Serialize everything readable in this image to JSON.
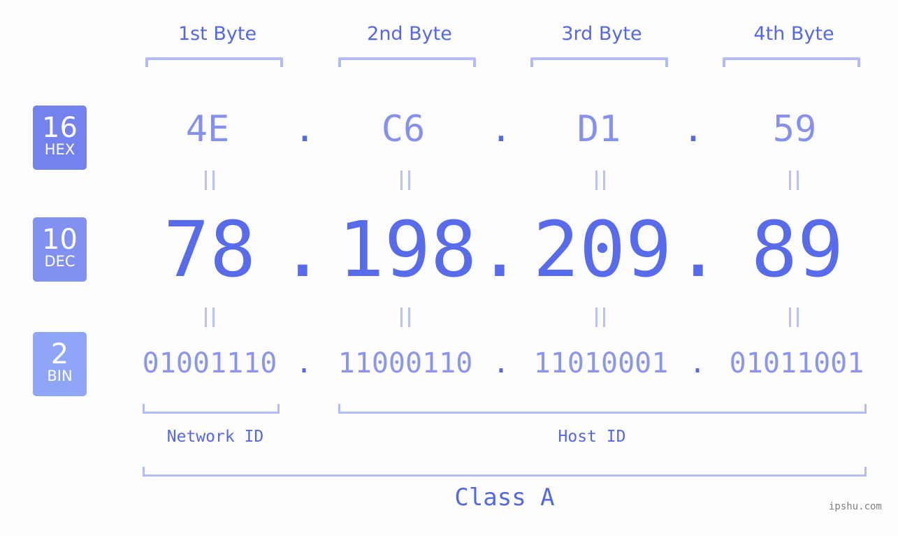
{
  "headers": [
    "1st Byte",
    "2nd Byte",
    "3rd Byte",
    "4th Byte"
  ],
  "badges": [
    {
      "num": "16",
      "label": "HEX",
      "color": "#7382ec"
    },
    {
      "num": "10",
      "label": "DEC",
      "color": "#8291f0"
    },
    {
      "num": "2",
      "label": "BIN",
      "color": "#8fa6f6"
    }
  ],
  "hex": [
    "4E",
    "C6",
    "D1",
    "59"
  ],
  "dec": [
    "78",
    "198",
    "209",
    "89"
  ],
  "bin": [
    "01001110",
    "11000110",
    "11010001",
    "01011001"
  ],
  "separator": ".",
  "equals": "=",
  "network_label": "Network ID",
  "host_label": "Host ID",
  "class_label": "Class A",
  "watermark": "ipshu.com"
}
